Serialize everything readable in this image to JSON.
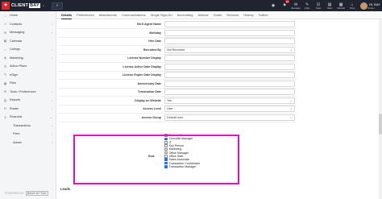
{
  "topbar": {
    "logo_glyph": "✦",
    "logo_brand1": "CLIENT",
    "logo_brand2": "BAY",
    "search_glyph": "⌕",
    "icons": [
      {
        "name": "dashboard-icon",
        "glyph": "◉",
        "label": ""
      },
      {
        "name": "notifications-icon",
        "glyph": "⚑",
        "label": "",
        "badge": "14"
      },
      {
        "name": "messages-icon",
        "glyph": "✉",
        "label": "Messages"
      },
      {
        "name": "pen-icon",
        "glyph": "✎",
        "label": "eSign"
      },
      {
        "name": "tasks-icon",
        "glyph": "☑",
        "label": "Tasks"
      },
      {
        "name": "notes-icon",
        "glyph": "▤",
        "label": "Notes"
      },
      {
        "name": "calendar-icon",
        "glyph": "▦",
        "label": "Calendar"
      },
      {
        "name": "home-icon",
        "glyph": "⌂",
        "label": "Home"
      }
    ],
    "user_name": "HI, BAY",
    "user_sub": "Broker"
  },
  "sidebar": {
    "items": [
      {
        "name": "sidebar-item-home",
        "icon": "home-icon",
        "glyph": "⌂",
        "label": "Home",
        "chevron": ""
      },
      {
        "name": "sidebar-item-contacts",
        "icon": "contacts-icon",
        "glyph": "☺",
        "label": "Contacts",
        "chevron": "›"
      },
      {
        "name": "sidebar-item-messaging",
        "icon": "messaging-icon",
        "glyph": "✉",
        "label": "Messaging",
        "chevron": "›"
      },
      {
        "name": "sidebar-item-calendar",
        "icon": "calendar-icon",
        "glyph": "▦",
        "label": "Calendar",
        "chevron": ""
      },
      {
        "name": "sidebar-item-listings",
        "icon": "listings-icon",
        "glyph": "⌂",
        "label": "Listings",
        "chevron": "›"
      },
      {
        "name": "sidebar-item-marketing",
        "icon": "marketing-icon",
        "glyph": "◈",
        "label": "Marketing",
        "chevron": "›"
      },
      {
        "name": "sidebar-item-action-plans",
        "icon": "action-plans-icon",
        "glyph": "☰",
        "label": "Action Plans",
        "chevron": ""
      },
      {
        "name": "sidebar-item-esign",
        "icon": "esign-icon",
        "glyph": "✎",
        "label": "eSign",
        "chevron": ""
      },
      {
        "name": "sidebar-item-files",
        "icon": "files-icon",
        "glyph": "▣",
        "label": "Files",
        "chevron": ""
      },
      {
        "name": "sidebar-item-tools",
        "icon": "tools-icon",
        "glyph": "⚙",
        "label": "Tools / Preferences",
        "chevron": "›"
      },
      {
        "name": "sidebar-item-reports",
        "icon": "reports-icon",
        "glyph": "▥",
        "label": "Reports",
        "chevron": "›"
      },
      {
        "name": "sidebar-item-roster",
        "icon": "roster-icon",
        "glyph": "☷",
        "label": "Roster",
        "chevron": "›"
      },
      {
        "name": "sidebar-item-financial",
        "icon": "financial-icon",
        "glyph": "$",
        "label": "Financial",
        "chevron": "⌄"
      }
    ],
    "subitems": [
      {
        "name": "sidebar-subitem-transactions",
        "label": "Transactions",
        "chevron": "›"
      },
      {
        "name": "sidebar-subitem-fees",
        "label": "Fees",
        "chevron": "›"
      },
      {
        "name": "sidebar-subitem-admin",
        "label": "Admin",
        "chevron": "›"
      }
    ],
    "powered_by": "POWERED BY",
    "powered_brand": "BACK AT YOU"
  },
  "tabs": [
    "Details",
    "Preferences",
    "Attachments",
    "Communications",
    "Single Sign-On",
    "Accounting",
    "Actions",
    "Goals",
    "Services",
    "History",
    "Switch"
  ],
  "form": {
    "fields": [
      {
        "label": "NILS Agent Name",
        "value": "",
        "select": false
      },
      {
        "label": "Birthday",
        "value": "",
        "select": false
      },
      {
        "label": "Hire Date",
        "value": "",
        "select": false
      },
      {
        "label": "Recruited By",
        "value": "Not Recruited",
        "select": true
      },
      {
        "label": "License Number Display",
        "value": "",
        "select": false
      },
      {
        "label": "License Active Date Display",
        "value": "",
        "select": false
      },
      {
        "label": "License Expire Date Display",
        "value": "",
        "select": false
      },
      {
        "label": "Anniversary Date",
        "value": "",
        "select": false
      },
      {
        "label": "Termination Date",
        "value": "",
        "select": false
      },
      {
        "label": "Display on Website",
        "value": "Yes",
        "select": true
      },
      {
        "label": "Access Level",
        "value": "User",
        "select": true
      },
      {
        "label": "Access Group",
        "value": "Default User",
        "select": true
      }
    ],
    "roles_label": "Role",
    "roles": [
      {
        "label": "Broker / Owner",
        "checked": false
      },
      {
        "label": "Checklist Manager",
        "checked": true
      },
      {
        "label": "IT",
        "checked": false
      },
      {
        "label": "Key Person",
        "checked": false
      },
      {
        "label": "Marketing",
        "checked": false
      },
      {
        "label": "Office Manager",
        "checked": false
      },
      {
        "label": "Office Staff",
        "checked": false
      },
      {
        "label": "Sales Associate",
        "checked": true
      },
      {
        "label": "Transaction Coordinator",
        "checked": true
      },
      {
        "label": "Transaction Manager",
        "checked": true
      }
    ],
    "section_leads": "Leads"
  },
  "colors": {
    "topbar": "#1f2430",
    "accent": "#d9262a",
    "highlight": "#e20fbf",
    "checkbox": "#2a73d8"
  }
}
